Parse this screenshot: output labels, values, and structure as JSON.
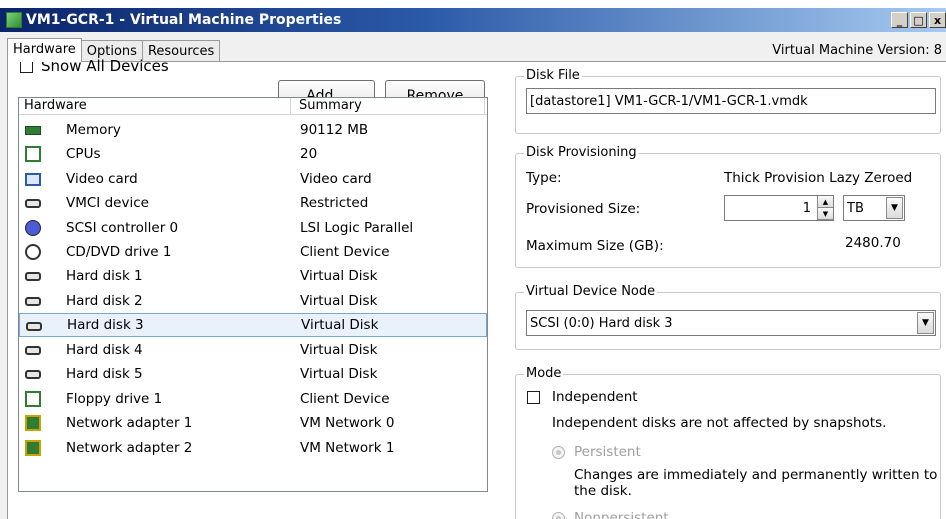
{
  "window": {
    "title": "VM1-GCR-1 - Virtual Machine Properties",
    "minimize_glyph": "_",
    "maximize_glyph": "□",
    "close_glyph": "x"
  },
  "tabs": [
    {
      "label": "Hardware",
      "active": true
    },
    {
      "label": "Options",
      "active": false
    },
    {
      "label": "Resources",
      "active": false
    }
  ],
  "vm_version": "Virtual Machine Version: 8",
  "hardware_panel": {
    "show_all_devices_label": "Show All Devices",
    "show_all_devices_checked": false,
    "add_button": "Add...",
    "remove_button": "Remove",
    "columns": [
      "Hardware",
      "Summary"
    ],
    "rows": [
      {
        "icon": "memory-icon",
        "name": "Memory",
        "summary": "90112 MB"
      },
      {
        "icon": "cpu-icon",
        "name": "CPUs",
        "summary": "20"
      },
      {
        "icon": "video-card-icon",
        "name": "Video card",
        "summary": "Video card"
      },
      {
        "icon": "vmci-device-icon",
        "name": "VMCI device",
        "summary": "Restricted"
      },
      {
        "icon": "scsi-controller-icon",
        "name": "SCSI controller 0",
        "summary": "LSI Logic Parallel"
      },
      {
        "icon": "cd-dvd-drive-icon",
        "name": "CD/DVD drive 1",
        "summary": "Client Device"
      },
      {
        "icon": "hard-disk-icon",
        "name": "Hard disk 1",
        "summary": "Virtual Disk"
      },
      {
        "icon": "hard-disk-icon",
        "name": "Hard disk 2",
        "summary": "Virtual Disk"
      },
      {
        "icon": "hard-disk-icon",
        "name": "Hard disk 3",
        "summary": "Virtual Disk",
        "selected": true
      },
      {
        "icon": "hard-disk-icon",
        "name": "Hard disk 4",
        "summary": "Virtual Disk"
      },
      {
        "icon": "hard-disk-icon",
        "name": "Hard disk 5",
        "summary": "Virtual Disk"
      },
      {
        "icon": "floppy-drive-icon",
        "name": "Floppy drive 1",
        "summary": "Client Device"
      },
      {
        "icon": "network-adapter-icon",
        "name": "Network adapter 1",
        "summary": "VM Network 0"
      },
      {
        "icon": "network-adapter-icon",
        "name": "Network adapter 2",
        "summary": "VM Network 1"
      }
    ]
  },
  "disk_file": {
    "legend": "Disk File",
    "path": "[datastore1] VM1-GCR-1/VM1-GCR-1.vmdk"
  },
  "disk_provisioning": {
    "legend": "Disk Provisioning",
    "type_label": "Type:",
    "type_value": "Thick Provision Lazy Zeroed",
    "provisioned_size_label": "Provisioned Size:",
    "provisioned_size_value": "1",
    "provisioned_size_unit": "TB",
    "maximum_size_label": "Maximum Size (GB):",
    "maximum_size_value": "2480.70"
  },
  "virtual_device_node": {
    "legend": "Virtual Device Node",
    "selected": "SCSI (0:0) Hard disk 3"
  },
  "mode": {
    "legend": "Mode",
    "independent_label": "Independent",
    "independent_checked": false,
    "independent_note": "Independent disks are not affected by snapshots.",
    "persistent_label": "Persistent",
    "persistent_note_line1": "Changes are immediately and permanently written to",
    "persistent_note_line2": "the disk.",
    "nonpersistent_label": "Nonpersistent"
  }
}
